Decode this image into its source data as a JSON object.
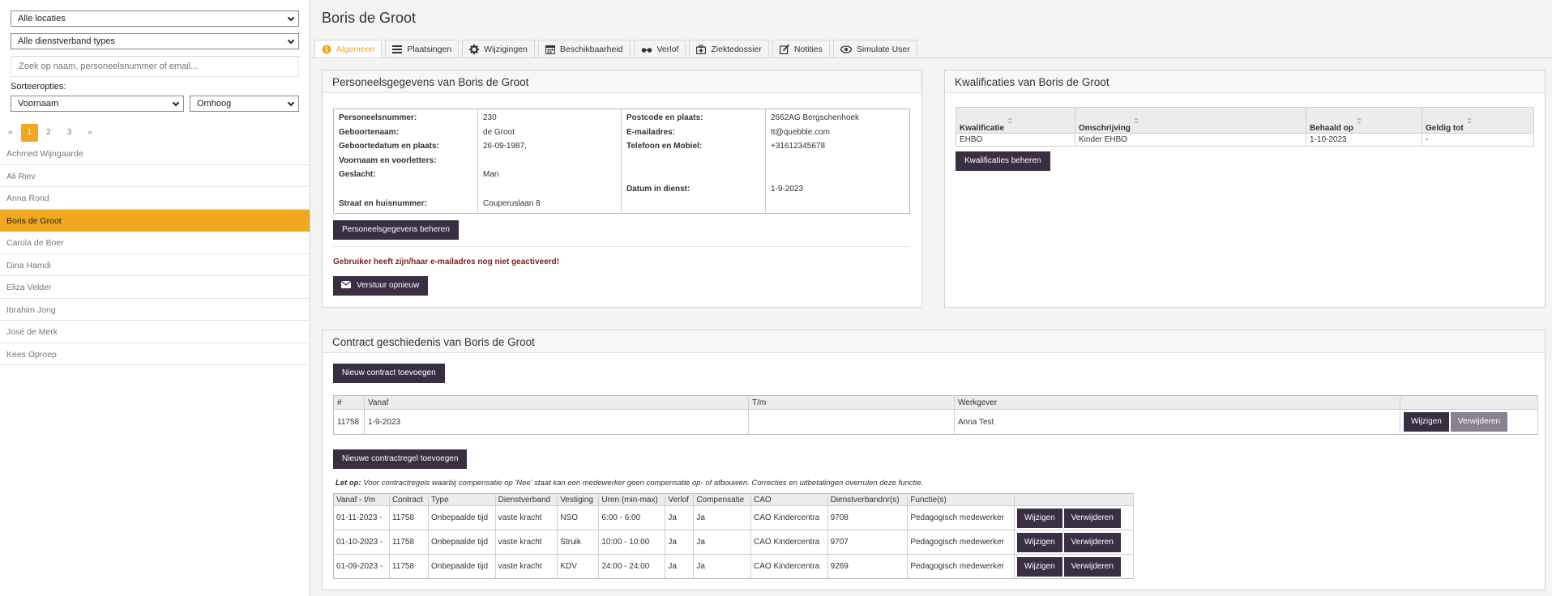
{
  "sidebar": {
    "location_select": "Alle locaties",
    "contract_type_select": "Alle dienstverband types",
    "search_placeholder": "Zoek op naam, personeelsnummer of email...",
    "sort_label": "Sorteeropties:",
    "sort_field": "Voornaam",
    "sort_direction": "Omhoog",
    "pagination": [
      "«",
      "1",
      "2",
      "3",
      "»"
    ],
    "pagination_active": "1",
    "employees": [
      "Achmed Wijngaarde",
      "Ali Riev",
      "Anna Rond",
      "Boris de Groot",
      "Carola de Boer",
      "Dina Hamdi",
      "Eliza Velder",
      "Ibrahim Jong",
      "José de Merk",
      "Kees Oproep"
    ],
    "selected_employee": "Boris de Groot"
  },
  "header": {
    "title": "Boris de Groot"
  },
  "tabs": [
    {
      "label": "Algemeen",
      "icon": "info-icon",
      "active": true
    },
    {
      "label": "Plaatsingen",
      "icon": "list-icon",
      "active": false
    },
    {
      "label": "Wijzigingen",
      "icon": "gear-icon",
      "active": false
    },
    {
      "label": "Beschikbaarheid",
      "icon": "calendar-icon",
      "active": false
    },
    {
      "label": "Verlof",
      "icon": "glasses-icon",
      "active": false
    },
    {
      "label": "Ziektedossier",
      "icon": "medkit-icon",
      "active": false
    },
    {
      "label": "Notities",
      "icon": "edit-icon",
      "active": false
    },
    {
      "label": "Simulate User",
      "icon": "eye-icon",
      "active": false
    }
  ],
  "personnel": {
    "title": "Personeelsgegevens van Boris de Groot",
    "left_labels": [
      "Personeelsnummer:",
      "Geboortenaam:",
      "Geboortedatum en plaats:",
      "Voornaam en voorletters:",
      "Geslacht:",
      "",
      "Straat en huisnummer:"
    ],
    "left_values": [
      "230",
      "de Groot",
      "26-09-1987,",
      "",
      "Man",
      "",
      "Couperuslaan 8"
    ],
    "right_labels": [
      "Postcode en plaats:",
      "E-mailadres:",
      "Telefoon en Mobiel:",
      "",
      "",
      "Datum in dienst:",
      ""
    ],
    "right_values": [
      "2662AG Bergschenhoek",
      "tt@quebble.com",
      "+31612345678",
      "",
      "",
      "1-9-2023",
      ""
    ],
    "manage_button": "Personeelsgegevens beheren",
    "warning": "Gebruiker heeft zijn/haar e-mailadres nog niet geactiveerd!",
    "resend_button": "Verstuur opnieuw"
  },
  "qualifications": {
    "title": "Kwalificaties van Boris de Groot",
    "columns": [
      "Kwalificatie",
      "Omschrijving",
      "Behaald op",
      "Geldig tot"
    ],
    "rows": [
      [
        "EHBO",
        "Kinder EHBO",
        "1-10-2023",
        "-"
      ]
    ],
    "manage_button": "Kwalificaties beheren"
  },
  "contracts": {
    "title": "Contract geschiedenis van Boris de Groot",
    "add_button": "Nieuw contract toevoegen",
    "columns": [
      "#",
      "Vanaf",
      "T/m",
      "Werkgever"
    ],
    "rows": [
      [
        "11758",
        "1-9-2023",
        "",
        "Anna Test"
      ]
    ],
    "edit_button": "Wijzigen",
    "delete_button": "Verwijderen",
    "add_rule_button": "Nieuwe contractregel toevoegen",
    "note_label": "Let op:",
    "note_text": " Voor contractregels waarbij compensatie op 'Nee' staat kan een medewerker geen compensatie op- of afbouwen. Correcties en uitbetalingen overrulen deze functie.",
    "rule_columns": [
      "Vanaf - t/m",
      "Contract",
      "Type",
      "Dienstverband",
      "Vestiging",
      "Uren (min-max)",
      "Verlof",
      "Compensatie",
      "CAO",
      "Dienstverbandnr(s)",
      "Functie(s)",
      ""
    ],
    "rule_rows": [
      [
        "01-11-2023 -",
        "11758",
        "Onbepaalde tijd",
        "vaste kracht",
        "NSO",
        "6:00 - 6:00",
        "Ja",
        "Ja",
        "CAO Kindercentra",
        "9708",
        "Pedagogisch medewerker"
      ],
      [
        "01-10-2023 -",
        "11758",
        "Onbepaalde tijd",
        "vaste kracht",
        "Struik",
        "10:00 - 10:00",
        "Ja",
        "Ja",
        "CAO Kindercentra",
        "9707",
        "Pedagogisch medewerker"
      ],
      [
        "01-09-2023 -",
        "11758",
        "Onbepaalde tijd",
        "vaste kracht",
        "KDV",
        "24:00 - 24:00",
        "Ja",
        "Ja",
        "CAO Kindercentra",
        "9269",
        "Pedagogisch medewerker"
      ]
    ]
  },
  "colors": {
    "accent": "#f0a81f",
    "dark_button": "#3a2e43",
    "warning_text": "#7a1f1f"
  }
}
